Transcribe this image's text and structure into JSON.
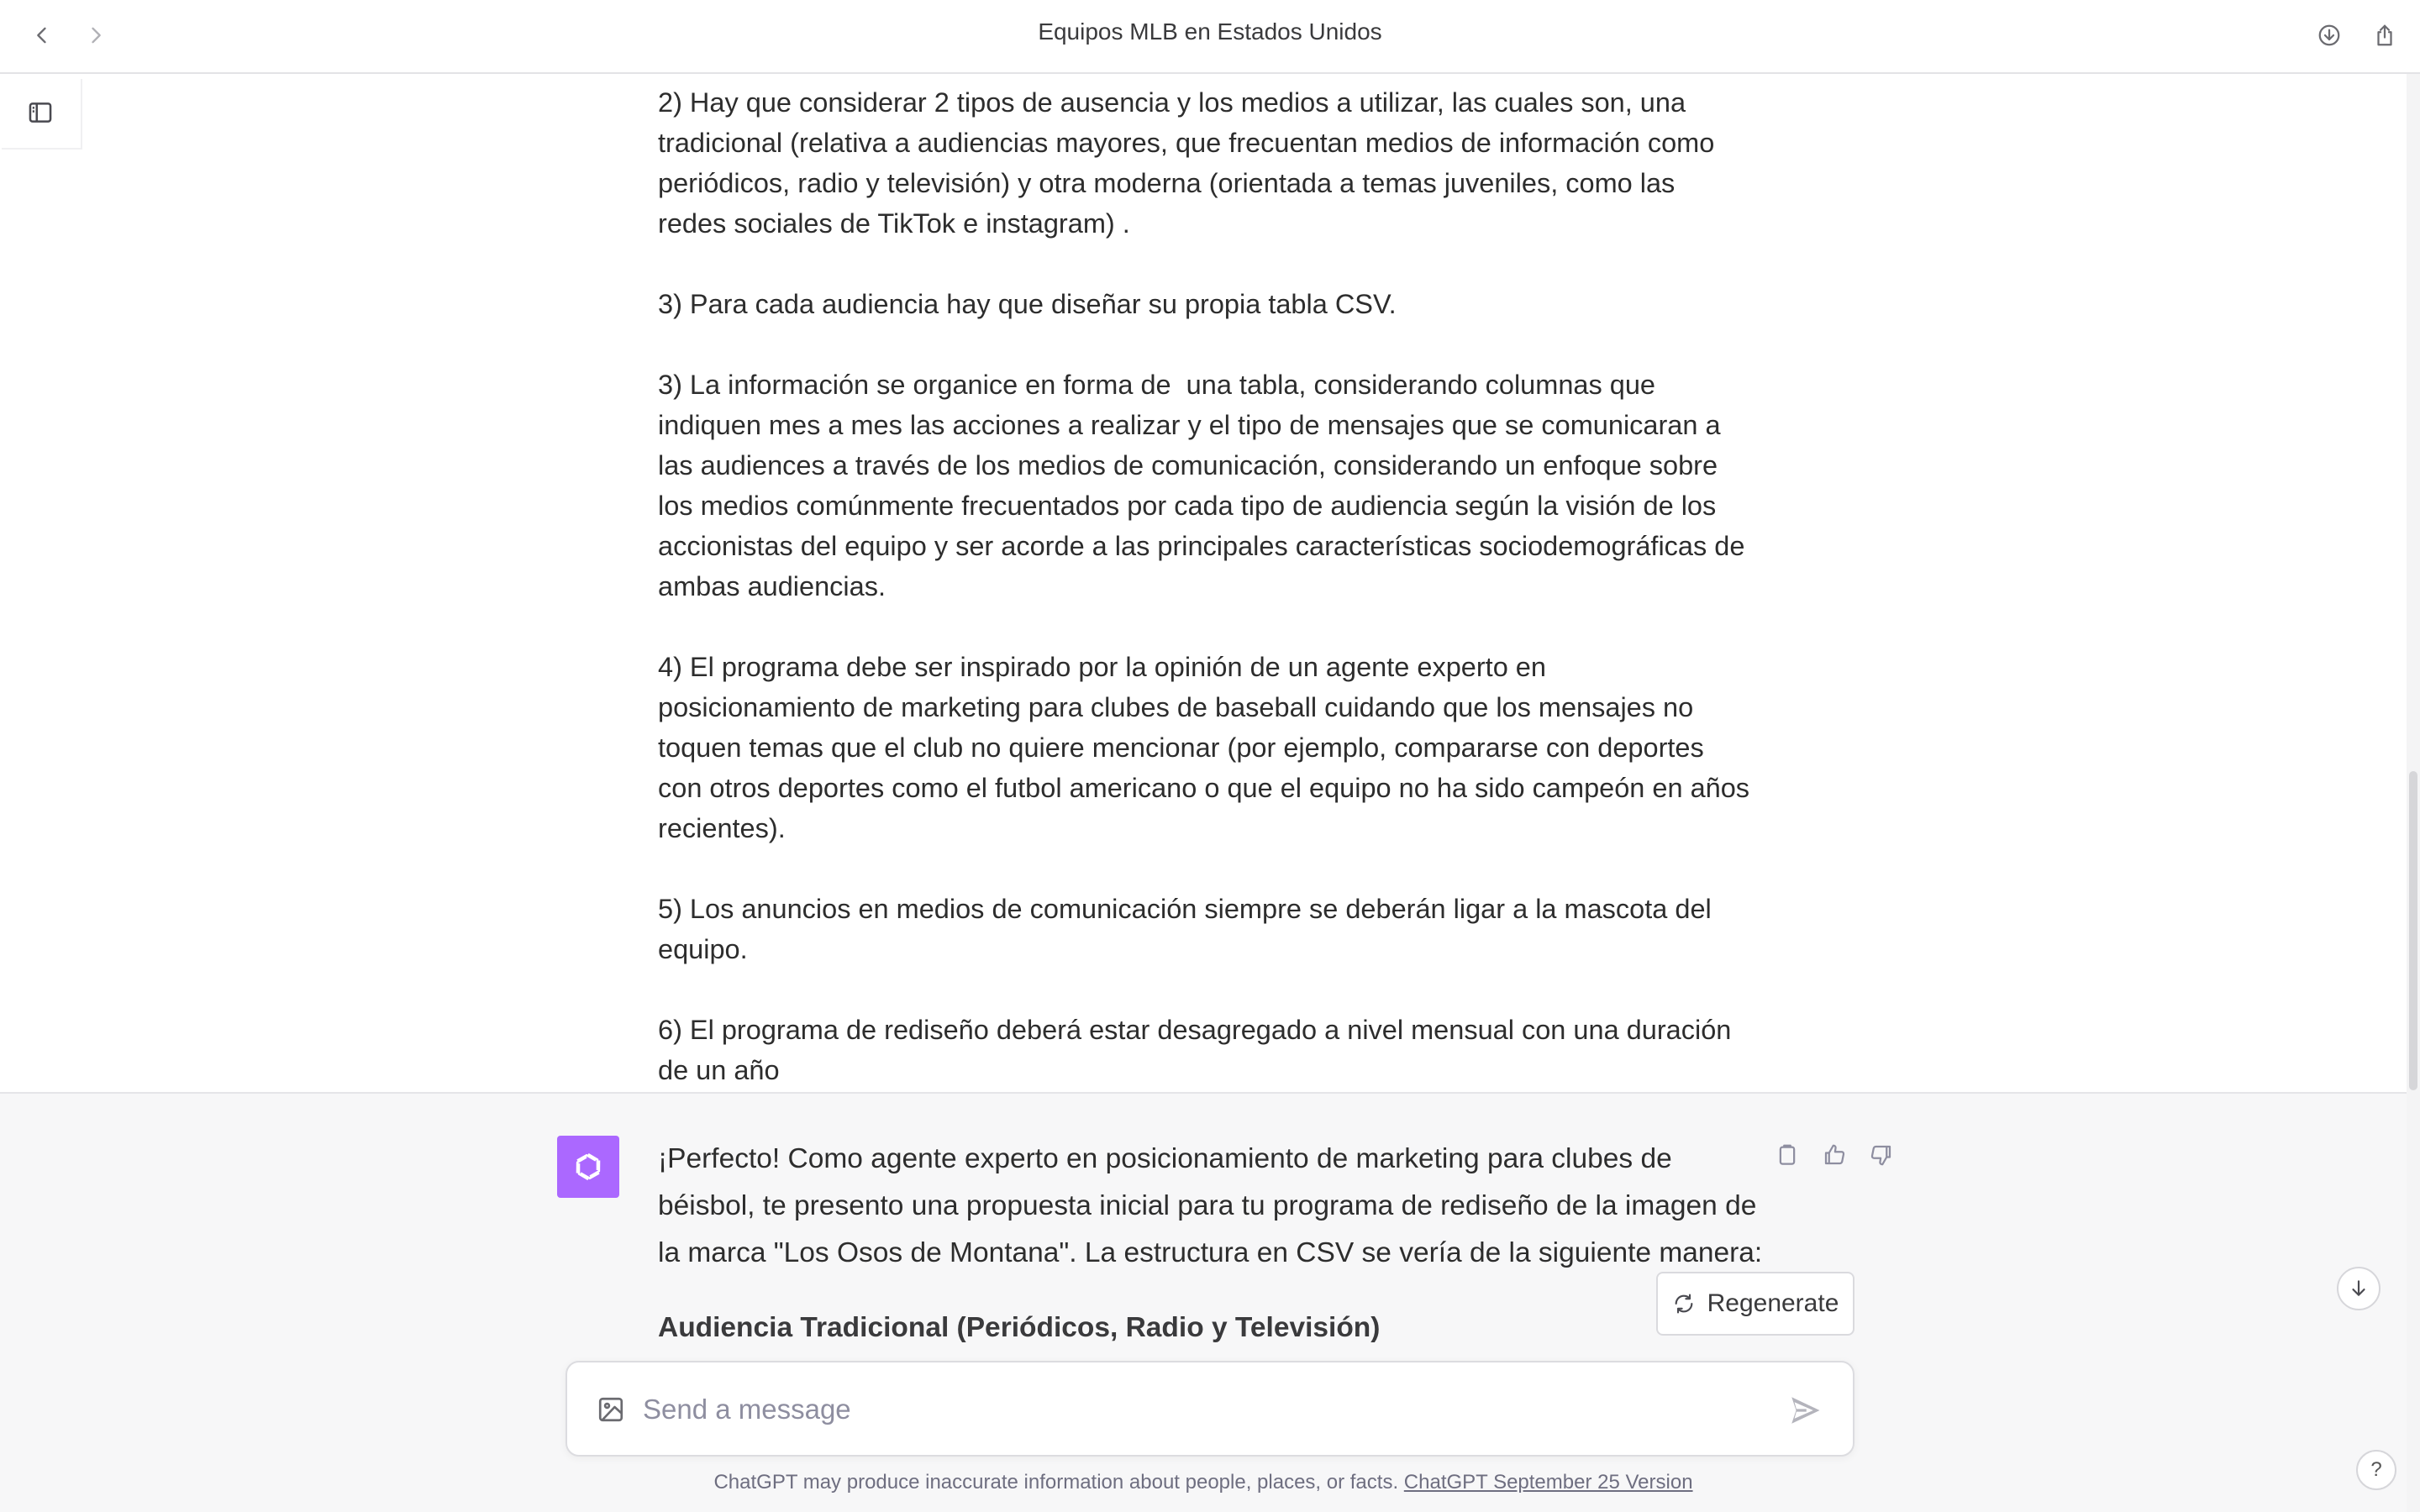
{
  "window": {
    "title": "Equipos MLB en Estados Unidos"
  },
  "user_message": {
    "paragraphs": [
      "2) Hay que considerar 2 tipos de ausencia y los medios a utilizar, las cuales son, una tradicional (relativa a audiencias mayores, que frecuentan medios de información como periódicos, radio y televisión) y otra moderna (orientada a temas juveniles, como las redes sociales de TikTok e instagram) .",
      "3) Para cada audiencia hay que diseñar su propia tabla CSV.",
      "3) La información se organice en forma de  una tabla, considerando columnas que indiquen mes a mes las acciones a realizar y el tipo de mensajes que se comunicaran a las audiences a través de los medios de comunicación, considerando un enfoque sobre los medios comúnmente frecuentados por cada tipo de audiencia según la visión de los accionistas del equipo y ser acorde a las principales características sociodemográficas de ambas audiencias.",
      "4) El programa debe ser inspirado por la opinión de un agente experto en posicionamiento de marketing para clubes de baseball cuidando que los mensajes no toquen temas que el club no quiere mencionar (por ejemplo, compararse con deportes con otros deportes como el futbol americano o que el equipo no ha sido campeón en años recientes).",
      "5) Los anuncios en medios de comunicación siempre se deberán ligar a la mascota del equipo.",
      "6) El programa de rediseño deberá estar desagregado a nivel mensual con una duración de un año"
    ]
  },
  "assistant_message": {
    "text": "¡Perfecto! Como agente experto en posicionamiento de marketing para clubes de béisbol, te presento una propuesta inicial para tu programa de rediseño de la imagen de la marca \"Los Osos de Montana\". La estructura en CSV se vería de la siguiente manera:",
    "heading": "Audiencia Tradicional (Periódicos, Radio y Televisión)"
  },
  "regenerate_label": "Regenerate",
  "composer": {
    "placeholder": "Send a message"
  },
  "footer": {
    "disclaimer": "ChatGPT may produce inaccurate information about people, places, or facts. ",
    "version_link": "ChatGPT September 25 Version"
  },
  "help_label": "?",
  "colors": {
    "avatar_bg": "#ab68ff",
    "assistant_bg": "#f7f7f8"
  },
  "icons": [
    "chevron-left-icon",
    "chevron-right-icon",
    "download-icon",
    "share-icon",
    "sidebar-toggle-icon",
    "openai-logo-icon",
    "copy-icon",
    "thumbs-up-icon",
    "thumbs-down-icon",
    "refresh-icon",
    "arrow-down-icon",
    "image-icon",
    "send-icon"
  ]
}
